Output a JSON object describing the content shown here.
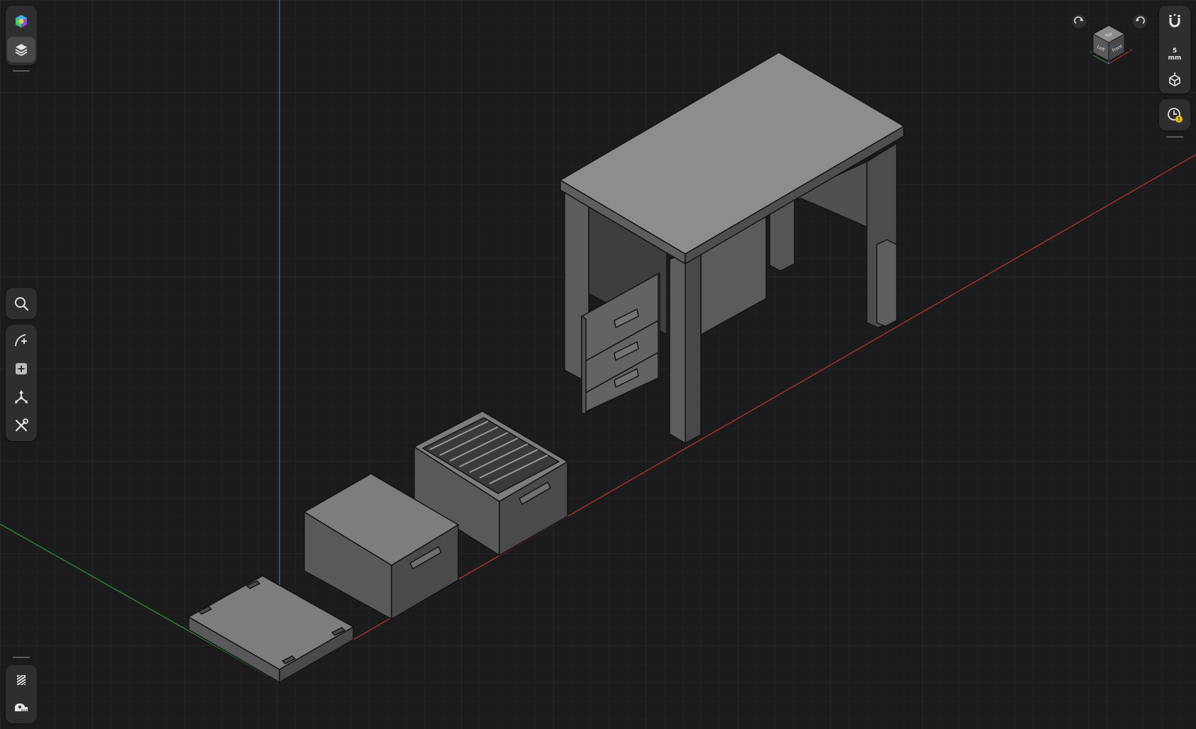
{
  "app": {
    "left_toolbar": {
      "top_tools": [
        {
          "name": "appearance-icon",
          "active": false
        },
        {
          "name": "layers-icon",
          "active": true
        }
      ],
      "middle_tools": [
        {
          "name": "search-icon"
        },
        {
          "name": "sketch-icon"
        },
        {
          "name": "add-icon"
        },
        {
          "name": "transform-icon"
        },
        {
          "name": "tools-icon"
        }
      ],
      "bottom_tools": [
        {
          "name": "section-view-icon"
        },
        {
          "name": "measure-icon"
        }
      ]
    },
    "right_toolbar": {
      "snap_value": "5",
      "snap_unit": "mm",
      "items": [
        {
          "name": "snap-magnet-icon"
        },
        {
          "name": "snap-increment"
        },
        {
          "name": "view-cube-toggle-icon"
        },
        {
          "name": "history-warning-icon"
        }
      ]
    },
    "view_cube": {
      "faces": {
        "top": "Top",
        "left": "Left",
        "front": "Front"
      },
      "axes": {
        "x": "X",
        "y": "Y",
        "z": "Z"
      }
    },
    "colors": {
      "background": "#1b1b1c",
      "grid_minor": "#262627",
      "grid_major": "#303032",
      "axis_x": "#b83232",
      "axis_y": "#2e8b3a",
      "axis_z": "#3a66d6",
      "toolbar_bg": "#2e2e30",
      "model_top": "#8c8c8e",
      "model_left": "#5a5a5c",
      "model_right": "#4a4a4c",
      "warning": "#f2c200"
    },
    "scene_objects": [
      "desk",
      "filing-box-open",
      "storage-box",
      "base-plate"
    ]
  }
}
